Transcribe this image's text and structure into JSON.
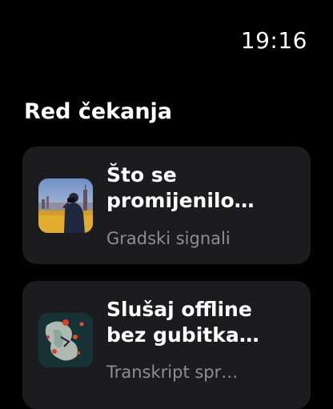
{
  "status_bar": {
    "time": "19:16"
  },
  "queue": {
    "title": "Red čekanja",
    "items": [
      {
        "title": "Što se\npromijenilo…",
        "subtitle": "Gradski signali",
        "artwork_icon": "city-photographer-artwork"
      },
      {
        "title": "Slušaj offline\nbez gubitka…",
        "subtitle": "Transkript spr…",
        "artwork_icon": "abstract-map-artwork"
      }
    ]
  }
}
